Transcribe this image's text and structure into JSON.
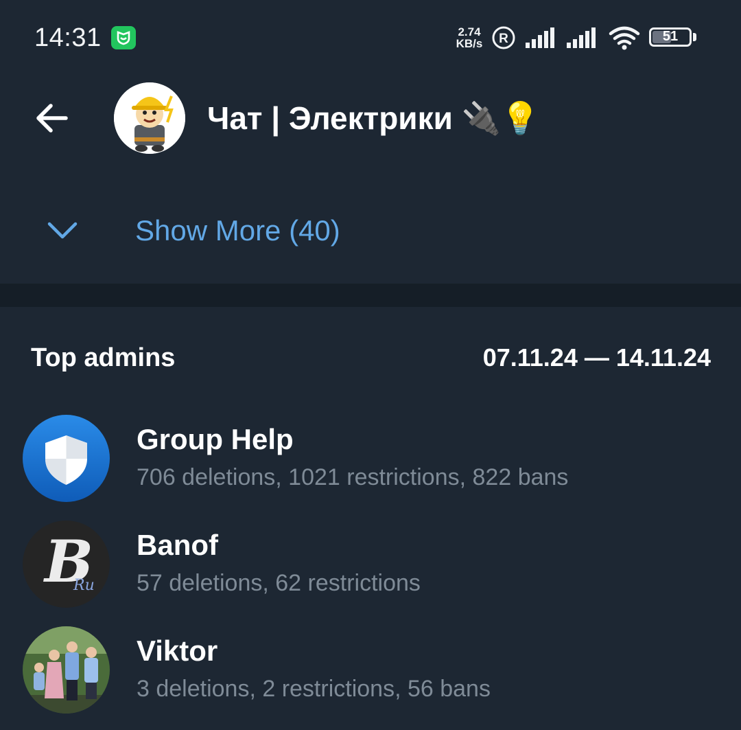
{
  "status_bar": {
    "time": "14:31",
    "net_speed_value": "2.74",
    "net_speed_unit": "KB/s",
    "battery": "51",
    "battery_level": 0.51,
    "icons": [
      "mi-app-icon",
      "registered-icon",
      "signal-icon",
      "signal-icon",
      "wifi-icon",
      "battery-icon"
    ]
  },
  "header": {
    "back_icon": "arrow-left-icon",
    "chat_title": "Чат | Электрики 🔌💡",
    "avatar": "electrician-cartoon-avatar"
  },
  "show_more": {
    "label": "Show More (40)",
    "icon": "chevron-down-icon",
    "accent": "#62a8e6"
  },
  "top_admins": {
    "title": "Top admins",
    "date_range": "07.11.24 — 14.11.24",
    "admins": [
      {
        "name": "Group Help",
        "stats": "706 deletions, 1021 restrictions, 822 bans",
        "avatar": "shield-avatar"
      },
      {
        "name": "Banof",
        "stats": "57 deletions, 62 restrictions",
        "avatar": "letter-b-avatar",
        "avatar_letter": "B",
        "avatar_sub": "Ru"
      },
      {
        "name": "Viktor",
        "stats": "3 deletions, 2 restrictions, 56 bans",
        "avatar": "family-photo-avatar"
      }
    ]
  },
  "colors": {
    "background": "#1d2733",
    "divider": "#151e27",
    "muted_text": "#7f8b97"
  }
}
